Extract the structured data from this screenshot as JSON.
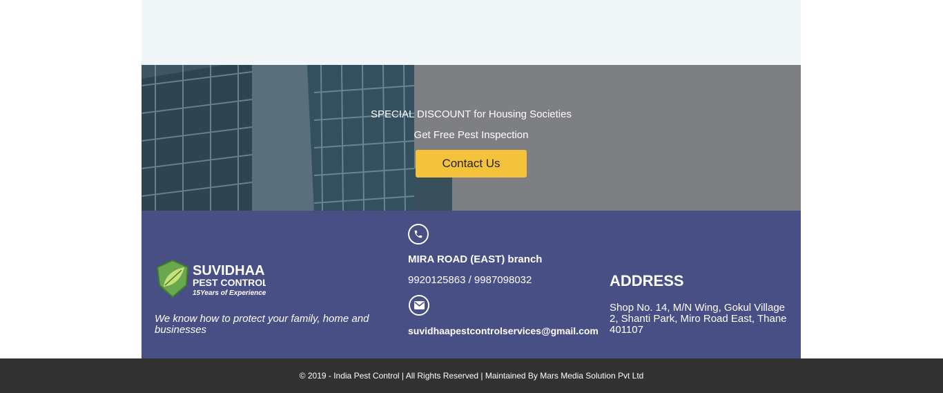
{
  "promo": {
    "line1": "SPECIAL DISCOUNT for Housing Societies",
    "line2": "Get Free Pest Inspection",
    "button_label": "Contact Us"
  },
  "footer": {
    "logo": {
      "name": "SUVIDHAA",
      "sub": "PEST CONTROL",
      "years": "15Years of Experience"
    },
    "tagline": "We know how to protect your family, home and businesses",
    "branch": "MIRA ROAD (EAST) branch",
    "phones": "9920125863 / 9987098032",
    "email": "suvidhaapestcontrolservices@gmail.com",
    "address_title": "ADDRESS",
    "address": "Shop No. 14, M/N Wing, Gokul Village 2, Shanti Park, Miro Road East, Thane 401107"
  },
  "copyright": "© 2019 - India Pest Control | All Rights Reserved | Maintained By Mars Media Solution Pvt Ltd",
  "colors": {
    "footer_bg": "#484f85",
    "button_bg": "#f5c33b",
    "bottom_bar": "#323232"
  },
  "icons": [
    "phone-icon",
    "mail-icon",
    "shield-leaf-icon"
  ]
}
